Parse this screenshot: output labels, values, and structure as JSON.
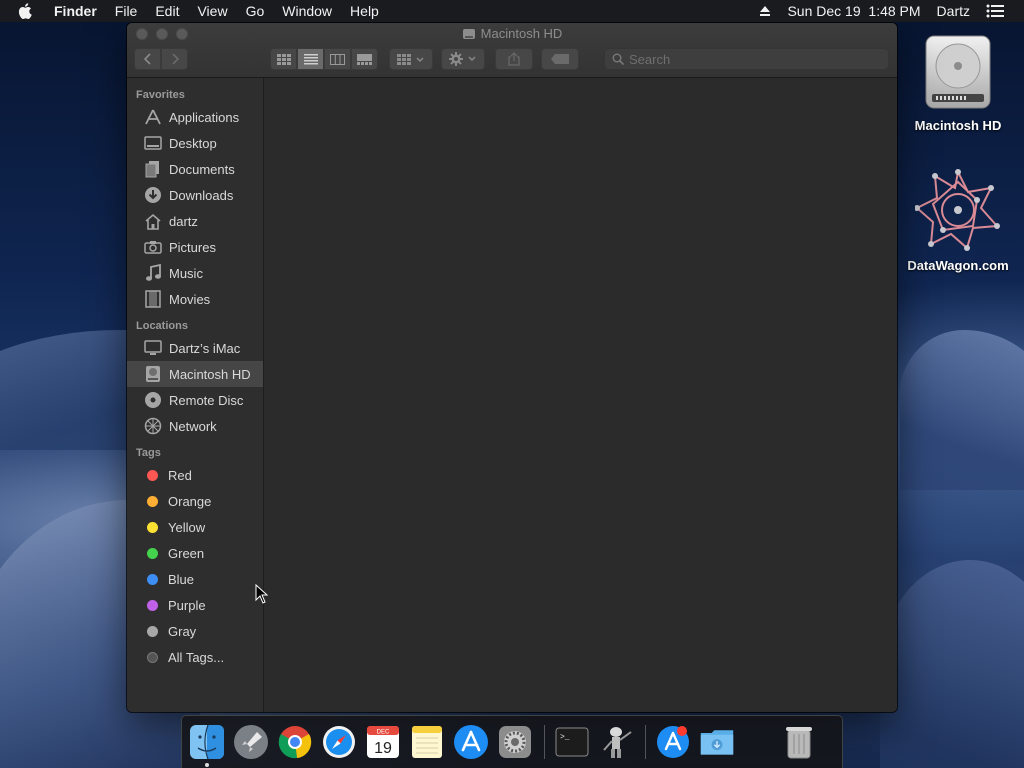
{
  "menubar": {
    "app_name": "Finder",
    "menus": [
      "File",
      "Edit",
      "View",
      "Go",
      "Window",
      "Help"
    ],
    "datetime": "Sun Dec 19  1:48 PM",
    "user": "Dartz"
  },
  "window": {
    "title": "Macintosh HD",
    "search_placeholder": "Search",
    "active_view": "list"
  },
  "sidebar": {
    "favorites_header": "Favorites",
    "favorites": [
      {
        "label": "Applications",
        "icon": "applications-icon"
      },
      {
        "label": "Desktop",
        "icon": "desktop-icon"
      },
      {
        "label": "Documents",
        "icon": "documents-icon"
      },
      {
        "label": "Downloads",
        "icon": "downloads-icon"
      },
      {
        "label": "dartz",
        "icon": "home-icon"
      },
      {
        "label": "Pictures",
        "icon": "camera-icon"
      },
      {
        "label": "Music",
        "icon": "music-note-icon"
      },
      {
        "label": "Movies",
        "icon": "film-icon"
      }
    ],
    "locations_header": "Locations",
    "locations": [
      {
        "label": "Dartz’s iMac",
        "icon": "computer-icon"
      },
      {
        "label": "Macintosh HD",
        "icon": "hard-drive-icon",
        "selected": true
      },
      {
        "label": "Remote Disc",
        "icon": "disc-icon"
      },
      {
        "label": "Network",
        "icon": "network-globe-icon"
      }
    ],
    "tags_header": "Tags",
    "tags": [
      {
        "label": "Red",
        "color": "#fc5753"
      },
      {
        "label": "Orange",
        "color": "#fdae34"
      },
      {
        "label": "Yellow",
        "color": "#fde132"
      },
      {
        "label": "Green",
        "color": "#44d34c"
      },
      {
        "label": "Blue",
        "color": "#3c8ef4"
      },
      {
        "label": "Purple",
        "color": "#c161e8"
      },
      {
        "label": "Gray",
        "color": "#a8a8a8"
      },
      {
        "label": "All Tags...",
        "color": null
      }
    ]
  },
  "desktop": {
    "icons": [
      {
        "label": "Macintosh HD",
        "icon": "hard-drive-icon"
      },
      {
        "label": "DataWagon.com",
        "icon": "network-star-icon"
      }
    ]
  },
  "dock": {
    "apps": [
      {
        "name": "finder-icon",
        "running": true
      },
      {
        "name": "launchpad-rocket-icon"
      },
      {
        "name": "chrome-icon"
      },
      {
        "name": "safari-compass-icon"
      },
      {
        "name": "calendar-icon",
        "month": "DEC",
        "day": "19"
      },
      {
        "name": "notes-icon"
      },
      {
        "name": "app-store-icon"
      },
      {
        "name": "system-preferences-gear-icon"
      },
      {
        "name": "terminal-icon"
      },
      {
        "name": "automator-robot-icon"
      },
      {
        "name": "app-store-badge-icon"
      },
      {
        "name": "downloads-folder-icon"
      },
      {
        "name": "trash-icon"
      }
    ]
  }
}
